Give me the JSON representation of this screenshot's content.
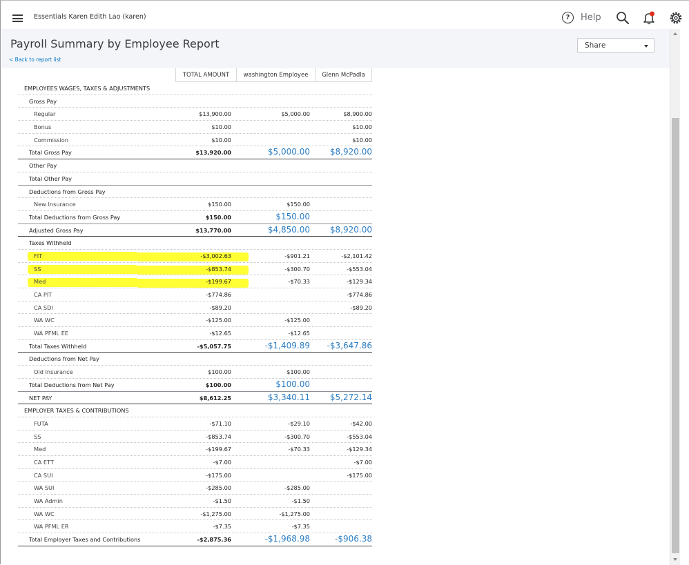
{
  "header": {
    "company": "Essentials Karen Edith Lao (karen)",
    "help_label": "Help",
    "help_glyph": "?"
  },
  "report": {
    "title": "Payroll Summary by Employee Report",
    "back_link": "< Back to report list",
    "share_label": "Share",
    "columns": [
      "TOTAL AMOUNT",
      "washington Employee",
      "Glenn McPadla"
    ],
    "highlight_color": "#ffff33",
    "link_color": "#2c7ec4"
  },
  "rows": [
    {
      "label": "EMPLOYEES WAGES, TAXES & ADJUSTMENTS",
      "lvl": 0,
      "v": [
        "",
        "",
        ""
      ]
    },
    {
      "label": "Gross Pay",
      "lvl": 1,
      "v": [
        "",
        "",
        ""
      ]
    },
    {
      "label": "Regular",
      "lvl": 2,
      "v": [
        "$13,900.00",
        "$5,000.00",
        "$8,900.00"
      ]
    },
    {
      "label": "Bonus",
      "lvl": 2,
      "v": [
        "$10.00",
        "",
        "$10.00"
      ]
    },
    {
      "label": "Commission",
      "lvl": 2,
      "v": [
        "$10.00",
        "",
        "$10.00"
      ]
    },
    {
      "label": "Total Gross Pay",
      "lvl": 1,
      "total": true,
      "blue": true,
      "v": [
        "$13,920.00",
        "$5,000.00",
        "$8,920.00"
      ]
    },
    {
      "label": "Other Pay",
      "lvl": 1,
      "v": [
        "",
        "",
        ""
      ]
    },
    {
      "label": "Total Other Pay",
      "lvl": 1,
      "total": true,
      "thin": true,
      "v": [
        "",
        "",
        ""
      ]
    },
    {
      "label": "Deductions from Gross Pay",
      "lvl": 1,
      "v": [
        "",
        "",
        ""
      ]
    },
    {
      "label": "New Insurance",
      "lvl": 2,
      "v": [
        "$150.00",
        "$150.00",
        ""
      ]
    },
    {
      "label": "Total Deductions from Gross Pay",
      "lvl": 1,
      "total": true,
      "thin": true,
      "blue": true,
      "v": [
        "$150.00",
        "$150.00",
        ""
      ]
    },
    {
      "label": "Adjusted Gross Pay",
      "lvl": 1,
      "total": true,
      "blue": true,
      "v": [
        "$13,770.00",
        "$4,850.00",
        "$8,920.00"
      ]
    },
    {
      "label": "Taxes Withheld",
      "lvl": 1,
      "v": [
        "",
        "",
        ""
      ]
    },
    {
      "label": "FIT",
      "lvl": 2,
      "hl": true,
      "v": [
        "-$3,002.63",
        "-$901.21",
        "-$2,101.42"
      ]
    },
    {
      "label": "SS",
      "lvl": 2,
      "hl": true,
      "v": [
        "-$853.74",
        "-$300.70",
        "-$553.04"
      ]
    },
    {
      "label": "Med",
      "lvl": 2,
      "hl": true,
      "v": [
        "-$199.67",
        "-$70.33",
        "-$129.34"
      ]
    },
    {
      "label": "CA PIT",
      "lvl": 2,
      "v": [
        "-$774.86",
        "",
        "-$774.86"
      ]
    },
    {
      "label": "CA SDI",
      "lvl": 2,
      "v": [
        "-$89.20",
        "",
        "-$89.20"
      ]
    },
    {
      "label": "WA WC",
      "lvl": 2,
      "v": [
        "-$125.00",
        "-$125.00",
        ""
      ]
    },
    {
      "label": "WA PFML EE",
      "lvl": 2,
      "v": [
        "-$12.65",
        "-$12.65",
        ""
      ]
    },
    {
      "label": "Total Taxes Withheld",
      "lvl": 1,
      "total": true,
      "blue": true,
      "v": [
        "-$5,057.75",
        "-$1,409.89",
        "-$3,647.86"
      ]
    },
    {
      "label": "Deductions from Net Pay",
      "lvl": 1,
      "v": [
        "",
        "",
        ""
      ]
    },
    {
      "label": "Old Insurance",
      "lvl": 2,
      "v": [
        "$100.00",
        "$100.00",
        ""
      ]
    },
    {
      "label": "Total Deductions from Net Pay",
      "lvl": 1,
      "total": true,
      "thin": true,
      "blue": true,
      "v": [
        "$100.00",
        "$100.00",
        ""
      ]
    },
    {
      "label": "NET PAY",
      "lvl": 1,
      "total": true,
      "blue": true,
      "v": [
        "$8,612.25",
        "$3,340.11",
        "$5,272.14"
      ]
    },
    {
      "label": "EMPLOYER TAXES & CONTRIBUTIONS",
      "lvl": 0,
      "v": [
        "",
        "",
        ""
      ]
    },
    {
      "label": "FUTA",
      "lvl": 2,
      "v": [
        "-$71.10",
        "-$29.10",
        "-$42.00"
      ]
    },
    {
      "label": "SS",
      "lvl": 2,
      "v": [
        "-$853.74",
        "-$300.70",
        "-$553.04"
      ]
    },
    {
      "label": "Med",
      "lvl": 2,
      "v": [
        "-$199.67",
        "-$70.33",
        "-$129.34"
      ]
    },
    {
      "label": "CA ETT",
      "lvl": 2,
      "v": [
        "-$7.00",
        "",
        "-$7.00"
      ]
    },
    {
      "label": "CA SUI",
      "lvl": 2,
      "v": [
        "-$175.00",
        "",
        "-$175.00"
      ]
    },
    {
      "label": "WA SUI",
      "lvl": 2,
      "v": [
        "-$285.00",
        "-$285.00",
        ""
      ]
    },
    {
      "label": "WA Admin",
      "lvl": 2,
      "v": [
        "-$1.50",
        "-$1.50",
        ""
      ]
    },
    {
      "label": "WA WC",
      "lvl": 2,
      "v": [
        "-$1,275.00",
        "-$1,275.00",
        ""
      ]
    },
    {
      "label": "WA PFML ER",
      "lvl": 2,
      "v": [
        "-$7.35",
        "-$7.35",
        ""
      ]
    },
    {
      "label": "Total Employer Taxes and Contributions",
      "lvl": 1,
      "total": true,
      "blue": true,
      "v": [
        "-$2,875.36",
        "-$1,968.98",
        "-$906.38"
      ]
    }
  ]
}
